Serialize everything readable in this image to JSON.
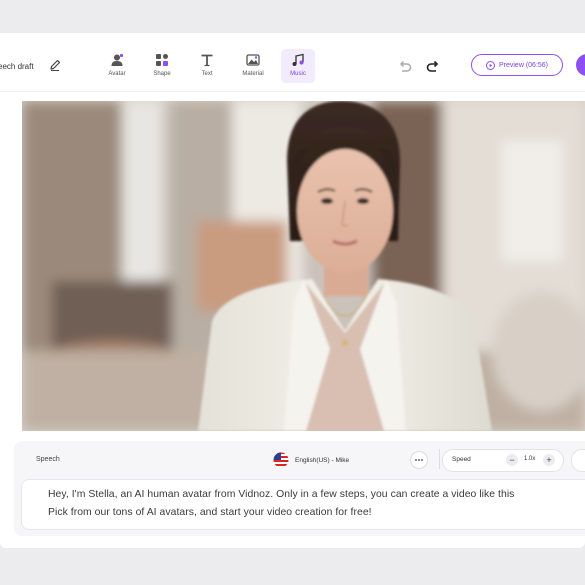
{
  "toolbar": {
    "draft_title": "eech draft",
    "tools": [
      {
        "label": "Avatar",
        "icon": "avatar-icon"
      },
      {
        "label": "Shape",
        "icon": "shape-icon"
      },
      {
        "label": "Text",
        "icon": "text-icon"
      },
      {
        "label": "Material",
        "icon": "material-icon"
      },
      {
        "label": "Music",
        "icon": "music-icon",
        "active": true
      }
    ],
    "preview_label": "Preview (06:56)"
  },
  "panel": {
    "speech_label": "Speech",
    "language": "English(US) - Mike",
    "speed_label": "Speed",
    "speed_value": "1.0x",
    "script_lines": [
      "Hey, I'm Stella, an AI human avatar from Vidnoz. Only in a few steps, you can create a video like this",
      "Pick from our tons of AI avatars, and start your video creation for free!"
    ]
  },
  "colors": {
    "accent": "#8e4ff0",
    "background": "#ececef",
    "panel": "#f6f6f9"
  }
}
